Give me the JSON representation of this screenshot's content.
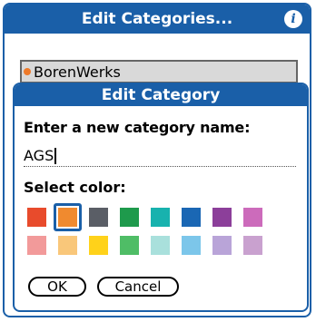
{
  "window": {
    "title": "Edit Categories...",
    "info_icon": "info-icon",
    "accent": "#1a5fa8"
  },
  "list": {
    "selected_item": "BorenWerks",
    "item_color": "#ee7a2a"
  },
  "dialog": {
    "title": "Edit Category",
    "prompt": "Enter a new category name:",
    "name_value": "AGS",
    "select_color_label": "Select color:",
    "swatch_rows": [
      [
        {
          "color": "#e84b2c",
          "selected": false
        },
        {
          "color": "#f08a2f",
          "selected": true
        },
        {
          "color": "#5a5e66",
          "selected": false
        },
        {
          "color": "#1e9a4c",
          "selected": false
        },
        {
          "color": "#18b2ae",
          "selected": false
        },
        {
          "color": "#1a67b4",
          "selected": false
        },
        {
          "color": "#8c3f9a",
          "selected": false
        },
        {
          "color": "#cc6bbb",
          "selected": false
        }
      ],
      [
        {
          "color": "#f29a9a",
          "selected": false
        },
        {
          "color": "#f9c77a",
          "selected": false
        },
        {
          "color": "#ffd21a",
          "selected": false
        },
        {
          "color": "#4fbd66",
          "selected": false
        },
        {
          "color": "#a9e0dc",
          "selected": false
        },
        {
          "color": "#7cc6ea",
          "selected": false
        },
        {
          "color": "#b9a4d8",
          "selected": false
        },
        {
          "color": "#c9a1cf",
          "selected": false
        }
      ]
    ],
    "ok_label": "OK",
    "cancel_label": "Cancel"
  }
}
